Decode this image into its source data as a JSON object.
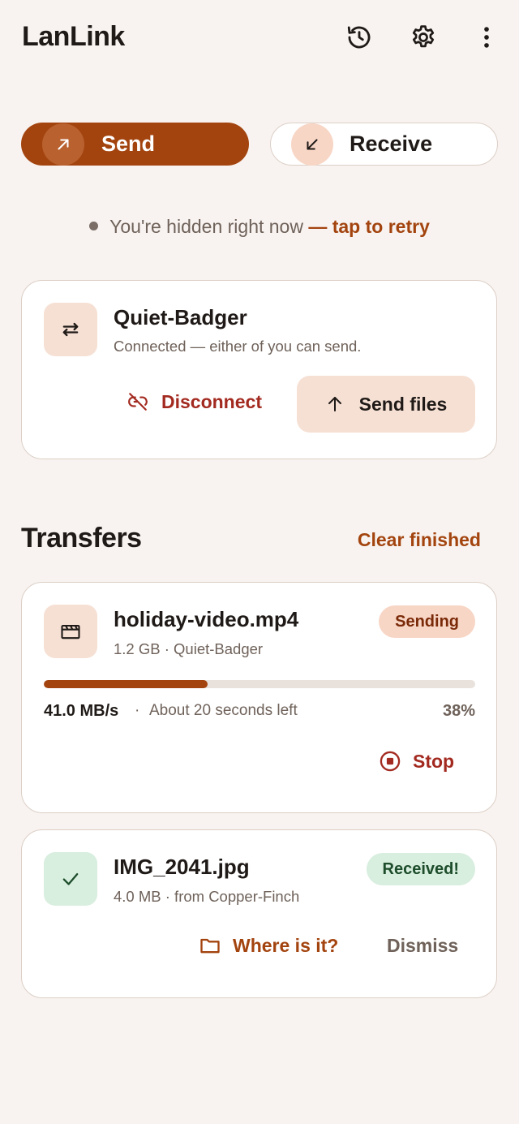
{
  "app": {
    "title": "LanLink"
  },
  "topbar": {
    "icons": [
      "history-icon",
      "gear-icon",
      "more-vert-icon"
    ]
  },
  "mode": {
    "send_label": "Send",
    "receive_label": "Receive",
    "selected": "Send"
  },
  "status": {
    "text": "You're hidden right now",
    "link": "— tap to retry"
  },
  "peer": {
    "name": "Quiet-Badger",
    "subtitle": "Connected — either of you can send.",
    "disconnect_label": "Disconnect",
    "send_files_label": "Send files"
  },
  "transfers": {
    "title": "Transfers",
    "clear_label": "Clear finished",
    "items": [
      {
        "name": "holiday-video.mp4",
        "meta": "1.2 GB · Quiet-Badger",
        "badge": "Sending",
        "speed": "41.0 MB/s",
        "separator": "·",
        "eta": "About 20 seconds left",
        "percent_label": "38%",
        "progress": 0.38,
        "stop_label": "Stop"
      },
      {
        "name": "IMG_2041.jpg",
        "meta": "4.0 MB · from Copper-Finch",
        "badge": "Received!",
        "where_label": "Where is it?",
        "dismiss_label": "Dismiss"
      }
    ]
  },
  "colors": {
    "background": "#f8f3f0",
    "accent": "#a3440f",
    "danger": "#a32a20",
    "success_bg": "#d8eedf",
    "accent_soft": "#f6e0d4"
  }
}
